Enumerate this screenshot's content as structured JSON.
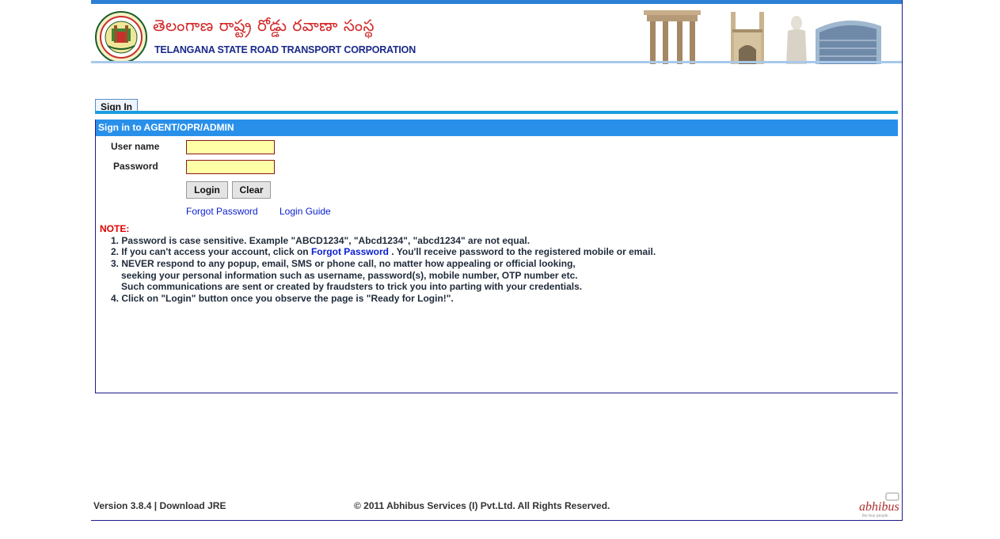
{
  "header": {
    "corp_name_telugu": "తెలంగాణ రాష్ట్ర రోడ్డు రవాణా సంస్థ",
    "corp_name_english": "TELANGANA STATE ROAD TRANSPORT CORPORATION",
    "brand_color": "#2e7fd6"
  },
  "tabs": [
    {
      "label": "Sign In",
      "active": true
    }
  ],
  "panel": {
    "title": "Sign in to AGENT/OPR/ADMIN",
    "username_label": "User name",
    "username_value": "",
    "password_label": "Password",
    "password_value": "",
    "login_label": "Login",
    "clear_label": "Clear",
    "forgot_password_label": "Forgot Password",
    "login_guide_label": "Login Guide"
  },
  "notes": {
    "title": "NOTE:",
    "n1": "1. Password is case sensitive. Example \"ABCD1234\", \"Abcd1234\", \"abcd1234\" are not equal.",
    "n2_pre": "2. If you can't access your account, click on ",
    "n2_link": "Forgot Password",
    "n2_post": " .  You'll receive password to the registered mobile or email.",
    "n3_a": "3. NEVER respond to any popup, email, SMS or phone call, no matter how appealing or official looking,",
    "n3_b": "seeking your personal information such as username, password(s), mobile number, OTP number etc.",
    "n3_c": "Such communications are sent or created by fraudsters to trick you into parting with your credentials.",
    "n4": "4. Click on \"Login\" button once you observe the page is \"Ready for Login!\"."
  },
  "footer": {
    "version": "Version 3.8.4",
    "separator": "|",
    "download_jre": "Download JRE",
    "copyright": "© 2011 Abhibus Services (I) Pvt.Ltd.  All Rights Reserved.",
    "logo_text": "abhibus",
    "logo_tagline": "the bus people"
  }
}
